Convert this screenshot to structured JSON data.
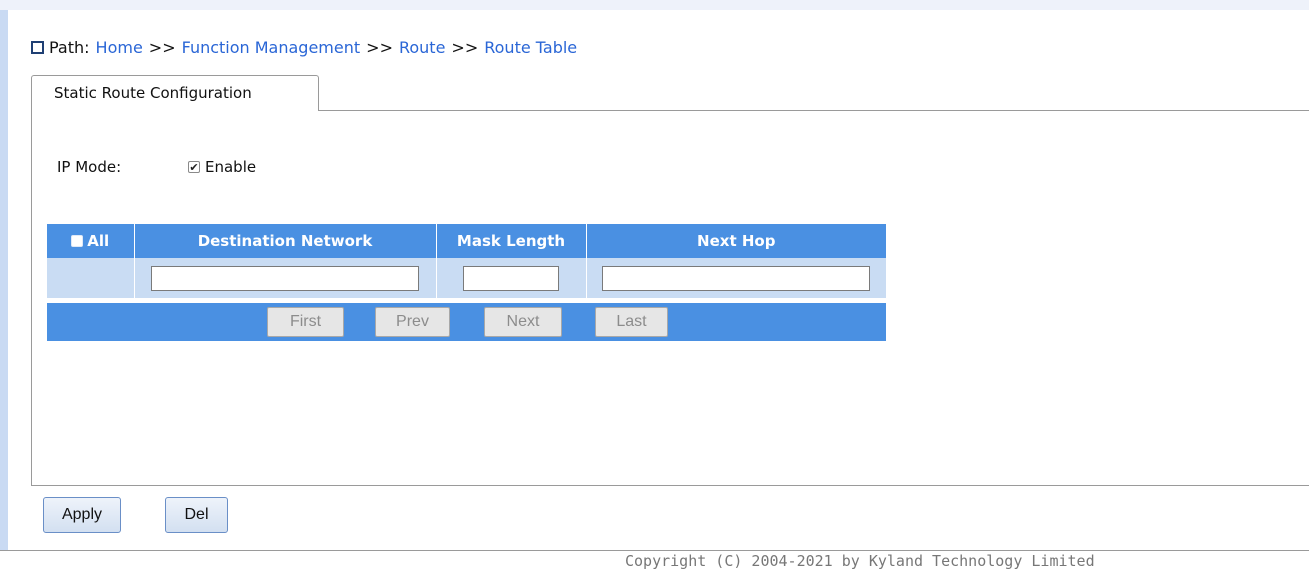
{
  "breadcrumb": {
    "label": "Path:",
    "items": [
      "Home",
      "Function Management",
      "Route",
      "Route Table"
    ],
    "separator": ">>"
  },
  "tab": {
    "label": "Static Route Configuration"
  },
  "ip_mode": {
    "label": "IP Mode:",
    "checkbox_label": "Enable",
    "checked": true
  },
  "table": {
    "select_all_label": "All",
    "columns": [
      "Destination Network",
      "Mask Length",
      "Next Hop"
    ],
    "row": {
      "destination": "",
      "mask_length": "",
      "next_hop": ""
    }
  },
  "pagination": {
    "first": "First",
    "prev": "Prev",
    "next": "Next",
    "last": "Last"
  },
  "actions": {
    "apply": "Apply",
    "del": "Del"
  },
  "footer": {
    "copyright": "Copyright (C) 2004-2021 by Kyland Technology Limited"
  },
  "colors": {
    "header_blue": "#4a90e2",
    "row_light": "#c9dcf3",
    "link": "#2a66d6"
  }
}
